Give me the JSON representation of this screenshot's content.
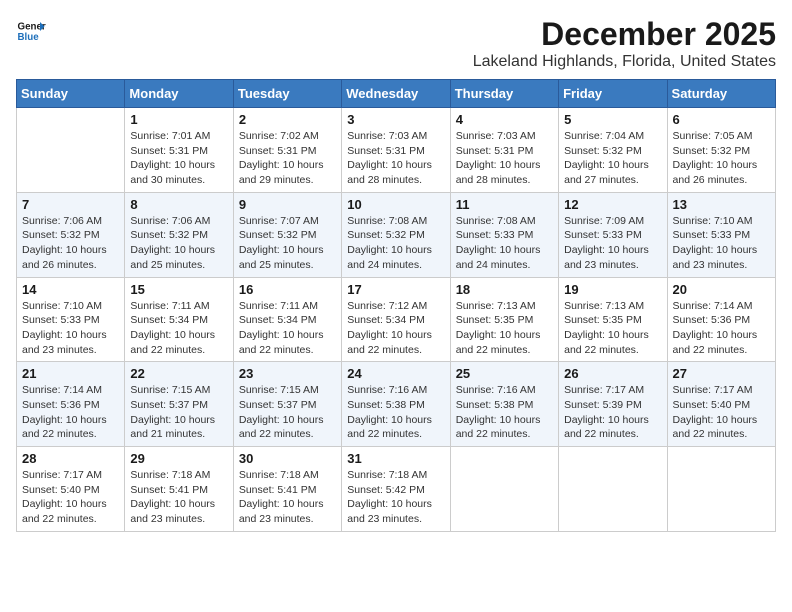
{
  "header": {
    "logo_general": "General",
    "logo_blue": "Blue",
    "title": "December 2025",
    "subtitle": "Lakeland Highlands, Florida, United States"
  },
  "weekdays": [
    "Sunday",
    "Monday",
    "Tuesday",
    "Wednesday",
    "Thursday",
    "Friday",
    "Saturday"
  ],
  "weeks": [
    [
      {
        "day": "",
        "sunrise": "",
        "sunset": "",
        "daylight": ""
      },
      {
        "day": "1",
        "sunrise": "Sunrise: 7:01 AM",
        "sunset": "Sunset: 5:31 PM",
        "daylight": "Daylight: 10 hours and 30 minutes."
      },
      {
        "day": "2",
        "sunrise": "Sunrise: 7:02 AM",
        "sunset": "Sunset: 5:31 PM",
        "daylight": "Daylight: 10 hours and 29 minutes."
      },
      {
        "day": "3",
        "sunrise": "Sunrise: 7:03 AM",
        "sunset": "Sunset: 5:31 PM",
        "daylight": "Daylight: 10 hours and 28 minutes."
      },
      {
        "day": "4",
        "sunrise": "Sunrise: 7:03 AM",
        "sunset": "Sunset: 5:31 PM",
        "daylight": "Daylight: 10 hours and 28 minutes."
      },
      {
        "day": "5",
        "sunrise": "Sunrise: 7:04 AM",
        "sunset": "Sunset: 5:32 PM",
        "daylight": "Daylight: 10 hours and 27 minutes."
      },
      {
        "day": "6",
        "sunrise": "Sunrise: 7:05 AM",
        "sunset": "Sunset: 5:32 PM",
        "daylight": "Daylight: 10 hours and 26 minutes."
      }
    ],
    [
      {
        "day": "7",
        "sunrise": "Sunrise: 7:06 AM",
        "sunset": "Sunset: 5:32 PM",
        "daylight": "Daylight: 10 hours and 26 minutes."
      },
      {
        "day": "8",
        "sunrise": "Sunrise: 7:06 AM",
        "sunset": "Sunset: 5:32 PM",
        "daylight": "Daylight: 10 hours and 25 minutes."
      },
      {
        "day": "9",
        "sunrise": "Sunrise: 7:07 AM",
        "sunset": "Sunset: 5:32 PM",
        "daylight": "Daylight: 10 hours and 25 minutes."
      },
      {
        "day": "10",
        "sunrise": "Sunrise: 7:08 AM",
        "sunset": "Sunset: 5:32 PM",
        "daylight": "Daylight: 10 hours and 24 minutes."
      },
      {
        "day": "11",
        "sunrise": "Sunrise: 7:08 AM",
        "sunset": "Sunset: 5:33 PM",
        "daylight": "Daylight: 10 hours and 24 minutes."
      },
      {
        "day": "12",
        "sunrise": "Sunrise: 7:09 AM",
        "sunset": "Sunset: 5:33 PM",
        "daylight": "Daylight: 10 hours and 23 minutes."
      },
      {
        "day": "13",
        "sunrise": "Sunrise: 7:10 AM",
        "sunset": "Sunset: 5:33 PM",
        "daylight": "Daylight: 10 hours and 23 minutes."
      }
    ],
    [
      {
        "day": "14",
        "sunrise": "Sunrise: 7:10 AM",
        "sunset": "Sunset: 5:33 PM",
        "daylight": "Daylight: 10 hours and 23 minutes."
      },
      {
        "day": "15",
        "sunrise": "Sunrise: 7:11 AM",
        "sunset": "Sunset: 5:34 PM",
        "daylight": "Daylight: 10 hours and 22 minutes."
      },
      {
        "day": "16",
        "sunrise": "Sunrise: 7:11 AM",
        "sunset": "Sunset: 5:34 PM",
        "daylight": "Daylight: 10 hours and 22 minutes."
      },
      {
        "day": "17",
        "sunrise": "Sunrise: 7:12 AM",
        "sunset": "Sunset: 5:34 PM",
        "daylight": "Daylight: 10 hours and 22 minutes."
      },
      {
        "day": "18",
        "sunrise": "Sunrise: 7:13 AM",
        "sunset": "Sunset: 5:35 PM",
        "daylight": "Daylight: 10 hours and 22 minutes."
      },
      {
        "day": "19",
        "sunrise": "Sunrise: 7:13 AM",
        "sunset": "Sunset: 5:35 PM",
        "daylight": "Daylight: 10 hours and 22 minutes."
      },
      {
        "day": "20",
        "sunrise": "Sunrise: 7:14 AM",
        "sunset": "Sunset: 5:36 PM",
        "daylight": "Daylight: 10 hours and 22 minutes."
      }
    ],
    [
      {
        "day": "21",
        "sunrise": "Sunrise: 7:14 AM",
        "sunset": "Sunset: 5:36 PM",
        "daylight": "Daylight: 10 hours and 22 minutes."
      },
      {
        "day": "22",
        "sunrise": "Sunrise: 7:15 AM",
        "sunset": "Sunset: 5:37 PM",
        "daylight": "Daylight: 10 hours and 21 minutes."
      },
      {
        "day": "23",
        "sunrise": "Sunrise: 7:15 AM",
        "sunset": "Sunset: 5:37 PM",
        "daylight": "Daylight: 10 hours and 22 minutes."
      },
      {
        "day": "24",
        "sunrise": "Sunrise: 7:16 AM",
        "sunset": "Sunset: 5:38 PM",
        "daylight": "Daylight: 10 hours and 22 minutes."
      },
      {
        "day": "25",
        "sunrise": "Sunrise: 7:16 AM",
        "sunset": "Sunset: 5:38 PM",
        "daylight": "Daylight: 10 hours and 22 minutes."
      },
      {
        "day": "26",
        "sunrise": "Sunrise: 7:17 AM",
        "sunset": "Sunset: 5:39 PM",
        "daylight": "Daylight: 10 hours and 22 minutes."
      },
      {
        "day": "27",
        "sunrise": "Sunrise: 7:17 AM",
        "sunset": "Sunset: 5:40 PM",
        "daylight": "Daylight: 10 hours and 22 minutes."
      }
    ],
    [
      {
        "day": "28",
        "sunrise": "Sunrise: 7:17 AM",
        "sunset": "Sunset: 5:40 PM",
        "daylight": "Daylight: 10 hours and 22 minutes."
      },
      {
        "day": "29",
        "sunrise": "Sunrise: 7:18 AM",
        "sunset": "Sunset: 5:41 PM",
        "daylight": "Daylight: 10 hours and 23 minutes."
      },
      {
        "day": "30",
        "sunrise": "Sunrise: 7:18 AM",
        "sunset": "Sunset: 5:41 PM",
        "daylight": "Daylight: 10 hours and 23 minutes."
      },
      {
        "day": "31",
        "sunrise": "Sunrise: 7:18 AM",
        "sunset": "Sunset: 5:42 PM",
        "daylight": "Daylight: 10 hours and 23 minutes."
      },
      {
        "day": "",
        "sunrise": "",
        "sunset": "",
        "daylight": ""
      },
      {
        "day": "",
        "sunrise": "",
        "sunset": "",
        "daylight": ""
      },
      {
        "day": "",
        "sunrise": "",
        "sunset": "",
        "daylight": ""
      }
    ]
  ]
}
